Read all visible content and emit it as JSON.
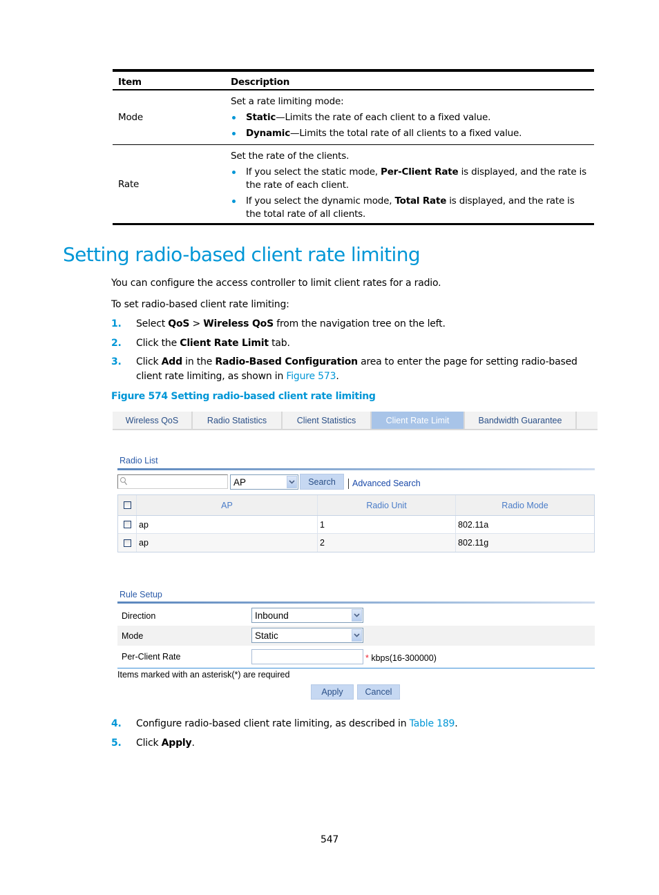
{
  "table": {
    "headers": [
      "Item",
      "Description"
    ],
    "rows": [
      {
        "item": "Mode",
        "intro": "Set a rate limiting mode:",
        "bullets": [
          {
            "bold": "Static",
            "text": "—Limits the rate of each client to a fixed value."
          },
          {
            "bold": "Dynamic",
            "text": "—Limits the total rate of all clients to a fixed value."
          }
        ]
      },
      {
        "item": "Rate",
        "intro": "Set the rate of the clients.",
        "bullets": [
          {
            "pre": "If you select the static mode, ",
            "bold": "Per-Client Rate",
            "text": " is displayed, and the rate is the rate of each client."
          },
          {
            "pre": " If you select the dynamic mode, ",
            "bold": "Total Rate",
            "text": " is displayed, and the rate is the total rate of all clients."
          }
        ]
      }
    ]
  },
  "section": {
    "title": "Setting radio-based client rate limiting",
    "intro": "You can configure the access controller to limit client rates for a radio.",
    "lead": "To set radio-based client rate limiting:",
    "steps": [
      {
        "num": "1.",
        "parts": [
          "Select ",
          "QoS",
          " > ",
          "Wireless QoS",
          " from the navigation tree on the left."
        ]
      },
      {
        "num": "2.",
        "parts": [
          "Click the ",
          "Client Rate Limit",
          " tab."
        ]
      },
      {
        "num": "3.",
        "parts": [
          "Click ",
          "Add",
          " in the ",
          "Radio-Based Configuration",
          " area to enter the page for setting radio-based client rate limiting, as shown in ",
          "Figure 573",
          "."
        ]
      },
      {
        "num": "4.",
        "parts": [
          "Configure radio-based client rate limiting, as described in ",
          "Table 189",
          "."
        ]
      },
      {
        "num": "5.",
        "parts": [
          "Click ",
          "Apply",
          "."
        ]
      }
    ],
    "figure_caption": "Figure 574 Setting radio-based client rate limiting"
  },
  "ui": {
    "tabs": [
      {
        "label": "Wireless QoS",
        "active": false
      },
      {
        "label": "Radio Statistics",
        "active": false
      },
      {
        "label": "Client Statistics",
        "active": false
      },
      {
        "label": "Client Rate Limit",
        "active": true
      },
      {
        "label": "Bandwidth Guarantee",
        "active": false
      }
    ],
    "radio_list": {
      "title": "Radio List",
      "search_value": "",
      "search_field": "AP",
      "search_button": "Search",
      "advanced_search": "Advanced Search",
      "columns": [
        "AP",
        "Radio Unit",
        "Radio Mode"
      ],
      "rows": [
        {
          "ap": "ap",
          "radio_unit": "1",
          "radio_mode": "802.11a",
          "checked": false
        },
        {
          "ap": "ap",
          "radio_unit": "2",
          "radio_mode": "802.11g",
          "checked": false
        }
      ]
    },
    "rule_setup": {
      "title": "Rule Setup",
      "direction_label": "Direction",
      "direction_value": "Inbound",
      "mode_label": "Mode",
      "mode_value": "Static",
      "rate_label": "Per-Client Rate",
      "rate_value": "",
      "required_mark": "*",
      "rate_hint": " kbps(16-300000)",
      "note": "Items marked with an asterisk(*) are required",
      "apply": "Apply",
      "cancel": "Cancel"
    }
  },
  "page_number": "547"
}
